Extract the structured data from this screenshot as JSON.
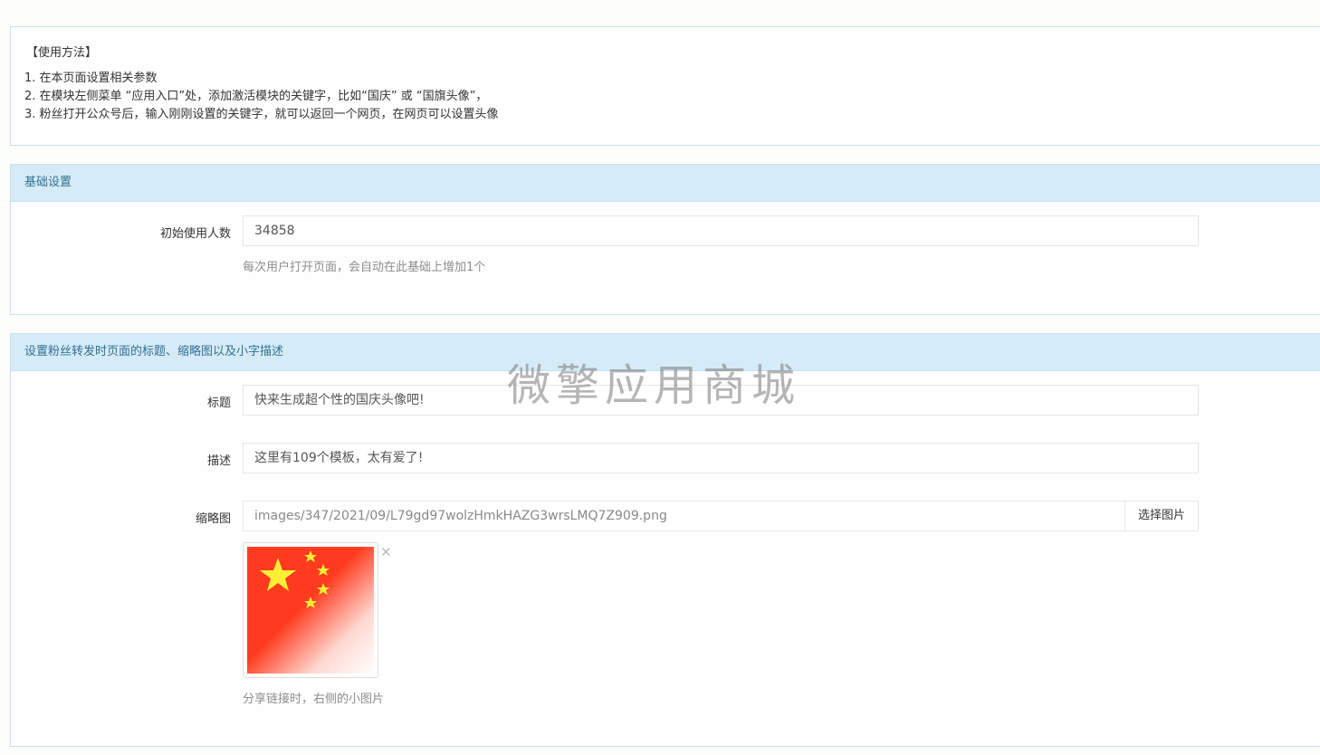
{
  "usage": {
    "title": "【使用方法】",
    "lines": [
      "1. 在本页面设置相关参数",
      "2. 在模块左侧菜单 “应用入口”处，添加激活模块的关键字，比如“国庆” 或 “国旗头像”，",
      "3. 粉丝打开公众号后，输入刚刚设置的关键字，就可以返回一个网页，在网页可以设置头像"
    ]
  },
  "basic": {
    "heading": "基础设置",
    "initial_users_label": "初始使用人数",
    "initial_users_value": "34858",
    "initial_users_help": "每次用户打开页面，会自动在此基础上增加1个"
  },
  "share": {
    "heading": "设置粉丝转发时页面的标题、缩略图以及小字描述",
    "title_label": "标题",
    "title_value": "快来生成超个性的国庆头像吧!",
    "desc_label": "描述",
    "desc_value": "这里有109个模板，太有爱了!",
    "thumb_label": "缩略图",
    "thumb_path": "images/347/2021/09/L79gd97wolzHmkHAZG3wrsLMQ7Z909.png",
    "choose_image_button": "选择图片",
    "remove_icon": "close-icon",
    "thumb_help": "分享链接时，右侧的小图片"
  },
  "watermark": "微擎应用商城",
  "colors": {
    "heading_bg": "#d5ebf8",
    "heading_text": "#31708f",
    "flag_red": "#ff3b1f",
    "flag_star": "#ffee33"
  }
}
